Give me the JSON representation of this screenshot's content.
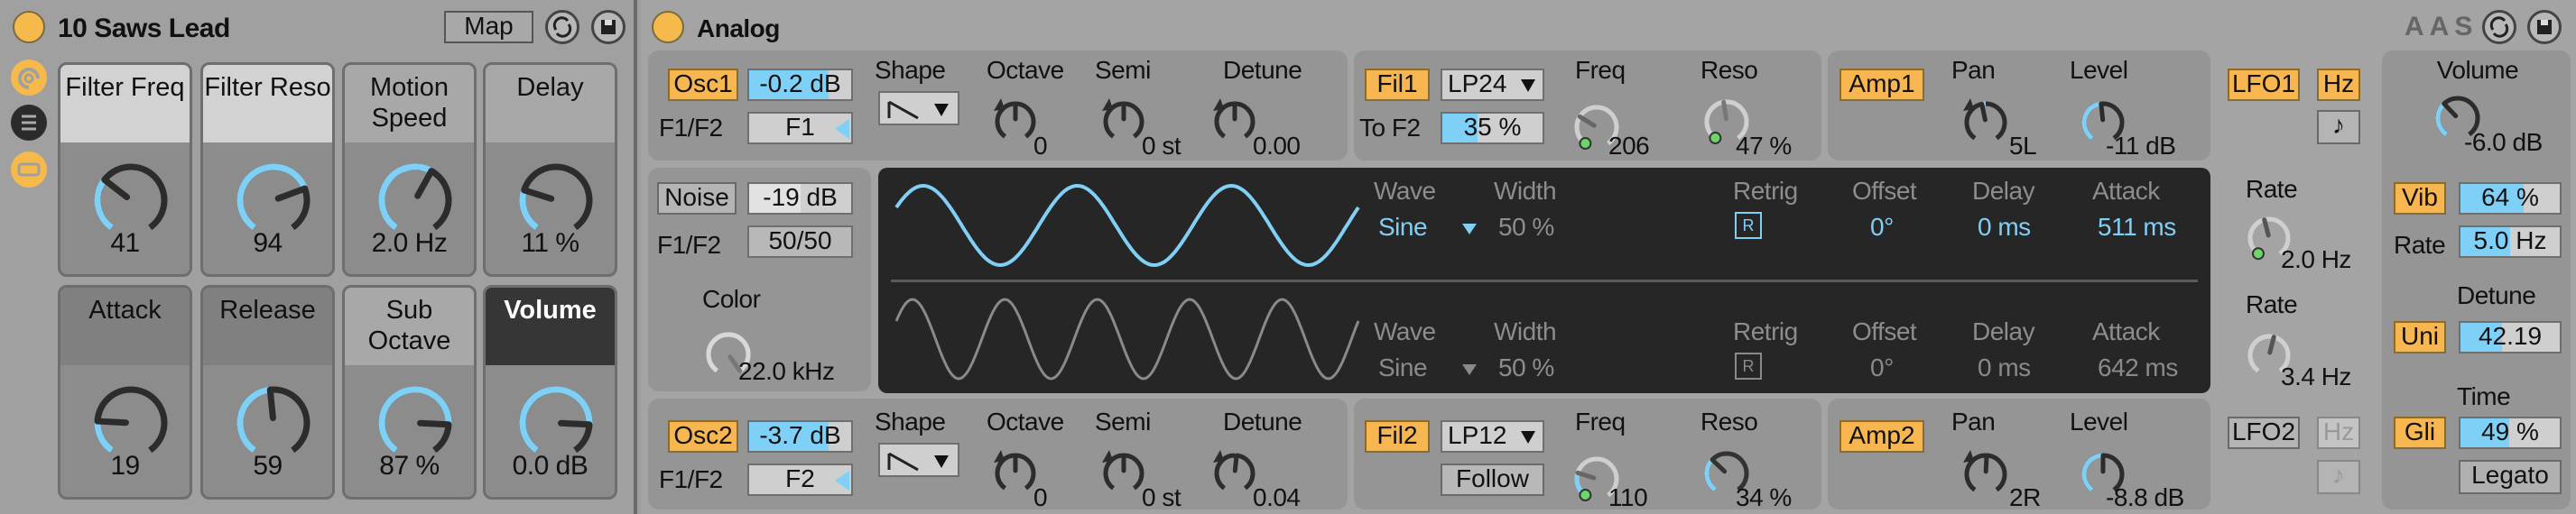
{
  "rack": {
    "title": "10 Saws Lead",
    "map_label": "Map",
    "macros": [
      {
        "label": "Filter Freq",
        "value": "41",
        "fill": 0.32,
        "header": "light"
      },
      {
        "label": "Filter Reso",
        "value": "94",
        "fill": 0.74,
        "header": "light"
      },
      {
        "label": "Motion Speed",
        "value": "2.0 Hz",
        "fill": 0.6,
        "header": "mid"
      },
      {
        "label": "Delay",
        "value": "11 %",
        "fill": 0.25,
        "header": "mid"
      },
      {
        "label": "Attack",
        "value": "19",
        "fill": 0.2,
        "header": "dark"
      },
      {
        "label": "Release",
        "value": "59",
        "fill": 0.48,
        "header": "dark"
      },
      {
        "label": "Sub Octave",
        "value": "87 %",
        "fill": 0.82,
        "header": "mid"
      },
      {
        "label": "Volume",
        "value": "0.0 dB",
        "fill": 0.82,
        "header": "selected"
      }
    ]
  },
  "analog": {
    "title": "Analog",
    "logo": "AAS",
    "osc1": {
      "button": "Osc1",
      "level": "-0.2 dB",
      "level_fill": 0.78,
      "f1f2_label": "F1/F2",
      "f1f2": "F1",
      "shape_label": "Shape",
      "octave_label": "Octave",
      "octave": "0",
      "octave_fill": 0.5,
      "semi_label": "Semi",
      "semi": "0 st",
      "semi_fill": 0.5,
      "detune_label": "Detune",
      "detune": "0.00",
      "detune_fill": 0.5
    },
    "osc2": {
      "button": "Osc2",
      "level": "-3.7 dB",
      "level_fill": 0.78,
      "f1f2_label": "F1/F2",
      "f1f2": "F2",
      "shape_label": "Shape",
      "octave_label": "Octave",
      "octave": "0",
      "octave_fill": 0.5,
      "semi_label": "Semi",
      "semi": "0 st",
      "semi_fill": 0.5,
      "detune_label": "Detune",
      "detune": "0.04",
      "detune_fill": 0.52
    },
    "fil1": {
      "button": "Fil1",
      "type": "LP24",
      "to_f2_label": "To F2",
      "to_f2": "35 %",
      "to_f2_fill": 0.35,
      "freq_label": "Freq",
      "freq": "206",
      "freq_fill": 0.3,
      "reso_label": "Reso",
      "reso": "47 %",
      "reso_fill": 0.47
    },
    "fil2": {
      "button": "Fil2",
      "type": "LP12",
      "follow": "Follow",
      "freq_label": "Freq",
      "freq": "110",
      "freq_fill": 0.25,
      "reso_label": "Reso",
      "reso": "34 %",
      "reso_fill": 0.34
    },
    "amp1": {
      "button": "Amp1",
      "pan_label": "Pan",
      "pan": "5L",
      "pan_fill": 0.46,
      "level_label": "Level",
      "level": "-11 dB",
      "level_fill": 0.48
    },
    "amp2": {
      "button": "Amp2",
      "pan_label": "Pan",
      "pan": "2R",
      "pan_fill": 0.51,
      "level_label": "Level",
      "level": "-8.8 dB",
      "level_fill": 0.5
    },
    "noise": {
      "button": "Noise",
      "level": "-19 dB",
      "level_fill": 0.5,
      "f1f2_label": "F1/F2",
      "f1f2": "50/50",
      "color_label": "Color",
      "color": "22.0 kHz",
      "color_fill": 1.0
    },
    "lfo_display": {
      "row1": {
        "wave_label": "Wave",
        "wave": "Sine",
        "width_label": "Width",
        "width": "50 %",
        "retrig_label": "Retrig",
        "retrig": "R",
        "offset_label": "Offset",
        "offset": "0°",
        "delay_label": "Delay",
        "delay": "0 ms",
        "attack_label": "Attack",
        "attack": "511 ms",
        "cycles": 3
      },
      "row2": {
        "wave_label": "Wave",
        "wave": "Sine",
        "width_label": "Width",
        "width": "50 %",
        "retrig_label": "Retrig",
        "retrig": "R",
        "offset_label": "Offset",
        "offset": "0°",
        "delay_label": "Delay",
        "delay": "0 ms",
        "attack_label": "Attack",
        "attack": "642 ms",
        "cycles": 5
      }
    },
    "lfo1": {
      "button": "LFO1",
      "hz": "Hz",
      "note": "♪",
      "rate_label": "Rate",
      "rate": "2.0 Hz",
      "rate_fill": 0.45
    },
    "lfo2": {
      "button": "LFO2",
      "hz": "Hz",
      "note": "♪",
      "rate_label": "Rate",
      "rate": "3.4 Hz",
      "rate_fill": 0.55
    },
    "global": {
      "volume_label": "Volume",
      "volume": "-6.0 dB",
      "volume_fill": 0.35,
      "vib": "Vib",
      "vib_amount": "64 %",
      "vib_fill": 0.64,
      "rate_label": "Rate",
      "rate": "5.0 Hz",
      "rate_fill": 0.5,
      "detune_label": "Detune",
      "uni": "Uni",
      "detune": "42.19",
      "detune_fill": 0.42,
      "time_label": "Time",
      "gli": "Gli",
      "time": "49 %",
      "time_fill": 0.49,
      "legato": "Legato"
    }
  },
  "colors": {
    "accent": "#f8b651",
    "blue": "#7fd0f7",
    "display": "#262626",
    "mod": "#6cd66a"
  }
}
